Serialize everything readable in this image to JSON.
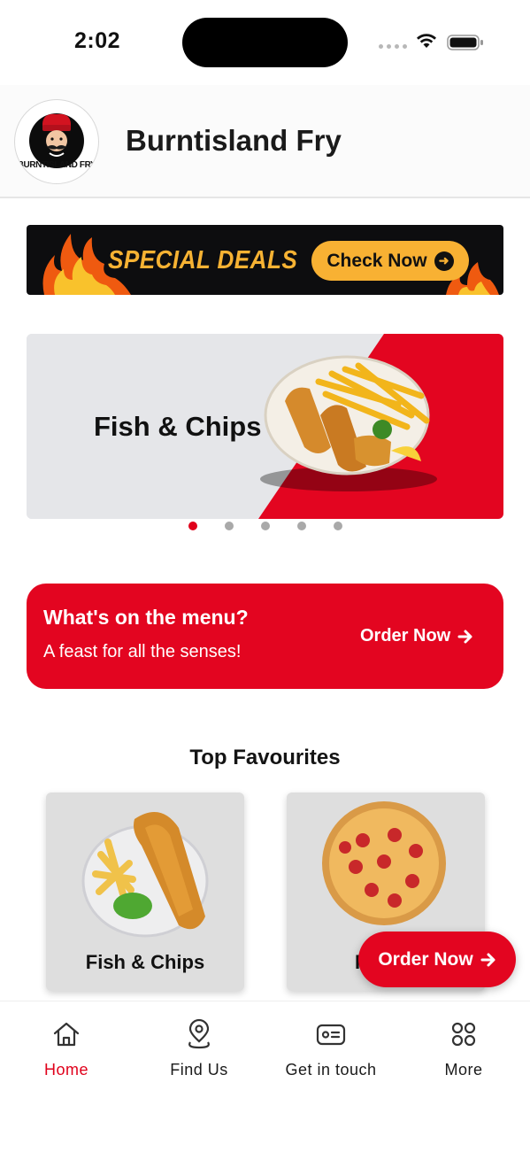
{
  "status_bar": {
    "time": "2:02"
  },
  "header": {
    "title": "Burntisland Fry",
    "logo_text": "BURNTISLAND FRY"
  },
  "deals_banner": {
    "text": "SPECIAL DEALS",
    "button_label": "Check Now"
  },
  "hero": {
    "title": "Fish & Chips",
    "slides_count": 5,
    "active_slide": 1
  },
  "menu_promo": {
    "title": "What's on the menu?",
    "subtitle": "A feast for all the senses!",
    "action_label": "Order Now"
  },
  "favourites": {
    "heading": "Top Favourites",
    "items": [
      {
        "name": "Fish & Chips"
      },
      {
        "name": "P"
      }
    ]
  },
  "fab": {
    "label": "Order Now"
  },
  "tabs": [
    {
      "label": "Home",
      "icon": "home-icon",
      "active": true
    },
    {
      "label": "Find Us",
      "icon": "location-pin-icon",
      "active": false
    },
    {
      "label": "Get in touch",
      "icon": "contact-card-icon",
      "active": false
    },
    {
      "label": "More",
      "icon": "grid-icon",
      "active": false
    }
  ],
  "colors": {
    "brand_red": "#e30520",
    "deal_orange": "#f8b133",
    "active_dot": "#e0001b"
  }
}
